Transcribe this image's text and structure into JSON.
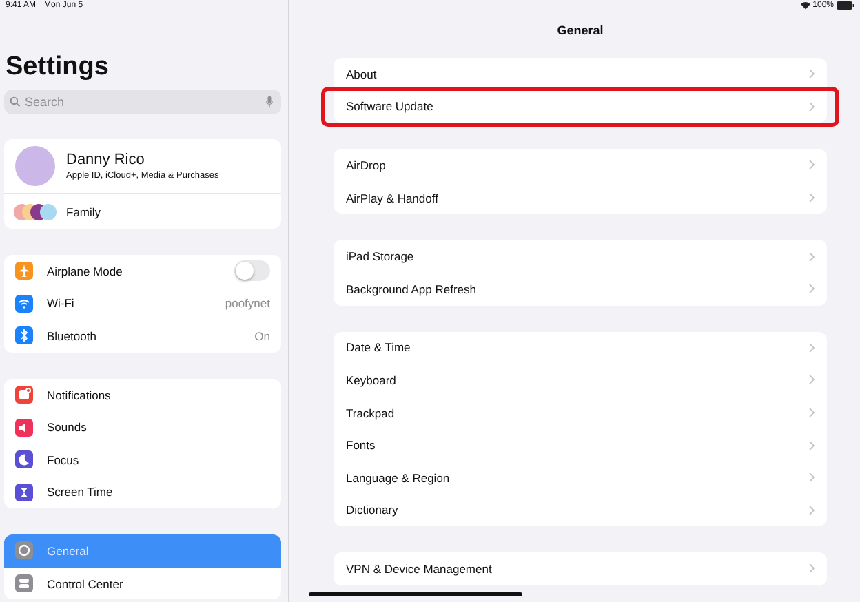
{
  "status_bar": {
    "time": "9:41 AM",
    "date": "Mon Jun 5",
    "battery": "100%"
  },
  "sidebar": {
    "title": "Settings",
    "search": {
      "placeholder": "Search"
    },
    "profile": {
      "name": "Danny Rico",
      "subtitle": "Apple ID, iCloud+, Media & Purchases",
      "family": "Family"
    },
    "groups": [
      {
        "items": [
          {
            "label": "Airplane Mode",
            "kind": "toggle",
            "on": false,
            "color": "#f7931e",
            "selected": false
          },
          {
            "label": "Wi-Fi",
            "kind": "value",
            "value": "poofynet",
            "color": "#1a82fb",
            "selected": false
          },
          {
            "label": "Bluetooth",
            "kind": "value",
            "value": "On",
            "color": "#1a82fb",
            "selected": false
          }
        ]
      },
      {
        "items": [
          {
            "label": "Notifications",
            "kind": "plain",
            "color": "#f0443a",
            "selected": false
          },
          {
            "label": "Sounds",
            "kind": "plain",
            "color": "#f0325a",
            "selected": false
          },
          {
            "label": "Focus",
            "kind": "plain",
            "color": "#5a50d6",
            "selected": false
          },
          {
            "label": "Screen Time",
            "kind": "plain",
            "color": "#5a50d6",
            "selected": false
          }
        ]
      },
      {
        "items": [
          {
            "label": "General",
            "kind": "plain",
            "color": "#8e8e93",
            "selected": true
          },
          {
            "label": "Control Center",
            "kind": "plain",
            "color": "#8e8e93",
            "selected": false
          }
        ]
      }
    ]
  },
  "detail": {
    "title": "General",
    "groups": [
      {
        "items": [
          {
            "label": "About",
            "highlighted": false
          },
          {
            "label": "Software Update",
            "highlighted": true
          }
        ]
      },
      {
        "items": [
          {
            "label": "AirDrop",
            "highlighted": false
          },
          {
            "label": "AirPlay & Handoff",
            "highlighted": false
          }
        ]
      },
      {
        "items": [
          {
            "label": "iPad Storage",
            "highlighted": false
          },
          {
            "label": "Background App Refresh",
            "highlighted": false
          }
        ]
      },
      {
        "items": [
          {
            "label": "Date & Time",
            "highlighted": false
          },
          {
            "label": "Keyboard",
            "highlighted": false
          },
          {
            "label": "Trackpad",
            "highlighted": false
          },
          {
            "label": "Fonts",
            "highlighted": false
          },
          {
            "label": "Language & Region",
            "highlighted": false
          },
          {
            "label": "Dictionary",
            "highlighted": false
          }
        ]
      },
      {
        "items": [
          {
            "label": "VPN & Device Management",
            "highlighted": false
          }
        ]
      }
    ]
  }
}
